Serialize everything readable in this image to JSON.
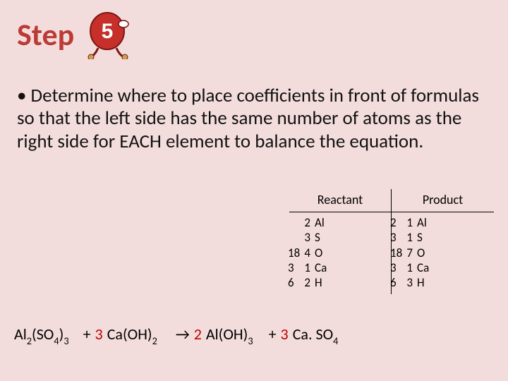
{
  "title": "Step",
  "icon_name": "number-five-character",
  "body": "• Determine where to place coefficients in front of formulas so that the left side has the same number of atoms as the right side for EACH element to balance the equation.",
  "table": {
    "headers": {
      "left": "Reactant",
      "right": "Product"
    },
    "rows": [
      {
        "elem": "Al",
        "reactant_old": "2",
        "reactant_new": "",
        "product_old": "1",
        "product_new": "2"
      },
      {
        "elem": "S",
        "reactant_old": "3",
        "reactant_new": "",
        "product_old": "1",
        "product_new": "3"
      },
      {
        "elem": "O",
        "reactant_old": "4",
        "reactant_new": "18",
        "product_old": "7",
        "product_new": "18"
      },
      {
        "elem": "Ca",
        "reactant_old": "1",
        "reactant_new": "3",
        "product_old": "1",
        "product_new": "3"
      },
      {
        "elem": "H",
        "reactant_old": "2",
        "reactant_new": "6",
        "product_old": "3",
        "product_new": "6"
      }
    ]
  },
  "equation": {
    "r1": {
      "formula": "Al",
      "sub1": "2",
      "anion": "(SO",
      "sub2": "4",
      "close": ")",
      "sub3": "3"
    },
    "plus1": "+",
    "coef_r2": "3",
    "r2": {
      "formula": "Ca(OH)",
      "sub1": "2"
    },
    "arrow": "→",
    "coef_p1": "2",
    "p1": {
      "formula": "Al(OH)",
      "sub1": "3"
    },
    "plus2": "+",
    "coef_p2": "3",
    "p2": {
      "formula": "Ca. SO",
      "sub1": "4"
    }
  }
}
